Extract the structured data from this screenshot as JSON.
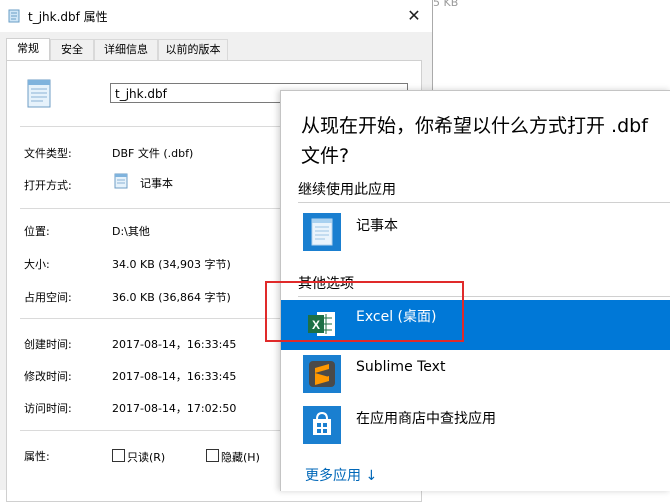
{
  "dialog": {
    "title": "t_jhk.dbf 属性",
    "close_glyph": "✕",
    "background_text": "5 KB",
    "tabs": [
      {
        "label": "常规"
      },
      {
        "label": "安全"
      },
      {
        "label": "详细信息"
      },
      {
        "label": "以前的版本"
      }
    ],
    "file_name": "t_jhk.dbf",
    "rows": {
      "file_type_label": "文件类型:",
      "file_type_value": "DBF 文件 (.dbf)",
      "open_with_label": "打开方式:",
      "open_with_value": "记事本",
      "location_label": "位置:",
      "location_value": "D:\\其他",
      "size_label": "大小:",
      "size_value": "34.0 KB (34,903 字节)",
      "disk_size_label": "占用空间:",
      "disk_size_value": "36.0 KB (36,864 字节)",
      "created_label": "创建时间:",
      "created_value": "2017-08-14，16:33:45",
      "modified_label": "修改时间:",
      "modified_value": "2017-08-14，16:33:45",
      "accessed_label": "访问时间:",
      "accessed_value": "2017-08-14，17:02:50",
      "attributes_label": "属性:",
      "readonly_label": "只读(R)",
      "hidden_label": "隐藏(H)"
    }
  },
  "flyout": {
    "title": "从现在开始，你希望以什么方式打开 .dbf 文件?",
    "continue_heading": "继续使用此应用",
    "current_app": "记事本",
    "other_heading": "其他选项",
    "apps": [
      {
        "name": "Excel (桌面)",
        "icon": "excel-icon",
        "selected": true
      },
      {
        "name": "Sublime Text",
        "icon": "sublime-text-icon",
        "selected": false
      },
      {
        "name": "在应用商店中查找应用",
        "icon": "store-icon",
        "selected": false
      }
    ],
    "more_apps": "更多应用 ↓"
  },
  "colors": {
    "accent": "#0078d7",
    "highlight_box": "#e02a2a",
    "link": "#0067b8"
  }
}
